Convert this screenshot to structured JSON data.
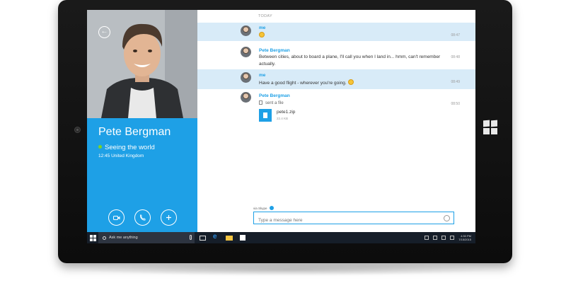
{
  "chat": {
    "day_label": "TODAY",
    "messages": [
      {
        "sender": "me",
        "text": "",
        "emoji": "smiley-emoji",
        "time": "08:47",
        "mine": true
      },
      {
        "sender": "Pete Bergman",
        "text": "Between cities, about to board a plane, I'll call you when I land in... hmm, can't remember actually.",
        "time": "08:48",
        "mine": false
      },
      {
        "sender": "me",
        "text": "Have a good flight - wherever you're going.",
        "emoji": "smiley-emoji",
        "time": "08:49",
        "mine": true
      },
      {
        "sender": "Pete Bergman",
        "text": "sent a file",
        "time": "08:50",
        "mine": false,
        "file": {
          "name": "pete1.zip",
          "size": "22.4 KB"
        }
      }
    ]
  },
  "profile": {
    "name": "Pete Bergman",
    "status": "Seeing the world",
    "local_time": "12:45 United Kingdom",
    "status_color": "#7ed321"
  },
  "composer": {
    "via": "via Skype",
    "placeholder": "Type a message here"
  },
  "taskbar": {
    "search_placeholder": "Ask me anything",
    "clock_time": "4:30 PM",
    "clock_date": "7/15/2015"
  },
  "colors": {
    "accent": "#1ea0e6",
    "taskbar": "#161e29",
    "my_message_bg": "#d8ebf8"
  }
}
